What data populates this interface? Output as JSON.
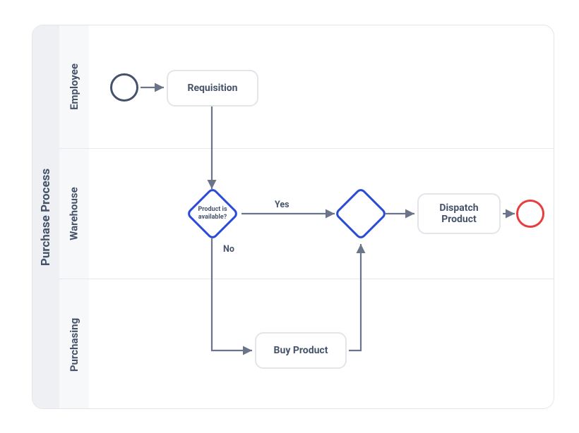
{
  "pool": {
    "title": "Purchase Process"
  },
  "lanes": {
    "employee": {
      "title": "Employee"
    },
    "warehouse": {
      "title": "Warehouse"
    },
    "purchasing": {
      "title": "Purchasing"
    }
  },
  "nodes": {
    "start": {
      "type": "start-event"
    },
    "requisition": {
      "label": "Requisition"
    },
    "gateway_check": {
      "label": "Product is available?"
    },
    "gateway_merge": {
      "label": ""
    },
    "dispatch": {
      "label": "Dispatch Product"
    },
    "buy": {
      "label": "Buy Product"
    },
    "end": {
      "type": "end-event"
    }
  },
  "edges": {
    "yes": {
      "label": "Yes"
    },
    "no": {
      "label": "No"
    }
  },
  "colors": {
    "border_light": "#e2e5ea",
    "text_dark": "#45536a",
    "gateway_blue": "#2a4ad8",
    "end_red": "#e83d3d",
    "arrow": "#6b7589"
  }
}
